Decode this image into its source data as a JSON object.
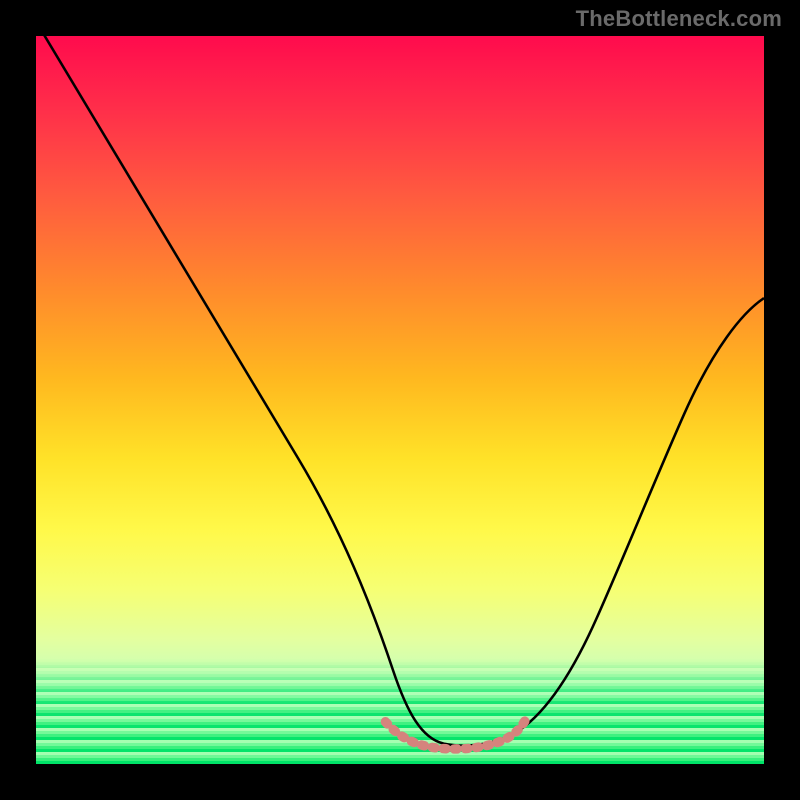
{
  "watermark": "TheBottleneck.com",
  "chart_data": {
    "type": "line",
    "title": "",
    "xlabel": "",
    "ylabel": "",
    "xlim": [
      0,
      100
    ],
    "ylim": [
      0,
      100
    ],
    "grid": false,
    "legend": false,
    "background": {
      "type": "vertical-gradient",
      "stops": [
        {
          "pos": 0,
          "color": "#ff0b4d"
        },
        {
          "pos": 35,
          "color": "#ff8b2c"
        },
        {
          "pos": 58,
          "color": "#ffe228"
        },
        {
          "pos": 83,
          "color": "#e3ffa0"
        },
        {
          "pos": 100,
          "color": "#00f26e"
        }
      ]
    },
    "series": [
      {
        "name": "curve",
        "stroke": "#000000",
        "stroke_width": 2,
        "x": [
          0,
          5,
          10,
          15,
          20,
          25,
          30,
          35,
          40,
          45,
          48,
          50,
          53,
          56,
          59,
          62,
          65,
          70,
          75,
          80,
          85,
          90,
          95,
          100
        ],
        "y": [
          102,
          94,
          85,
          76,
          67,
          58,
          49,
          40,
          31,
          20,
          12,
          6,
          3,
          2,
          2,
          2,
          3,
          6,
          12,
          22,
          34,
          47,
          56,
          63
        ]
      },
      {
        "name": "floor-mark",
        "stroke": "#d5837d",
        "stroke_width": 9,
        "dash": "2 3",
        "x": [
          48,
          50,
          52,
          54,
          56,
          58,
          60,
          62,
          64,
          66
        ],
        "y": [
          5,
          3,
          2,
          2,
          2,
          2,
          2,
          3,
          4,
          6
        ]
      }
    ],
    "annotations": []
  }
}
